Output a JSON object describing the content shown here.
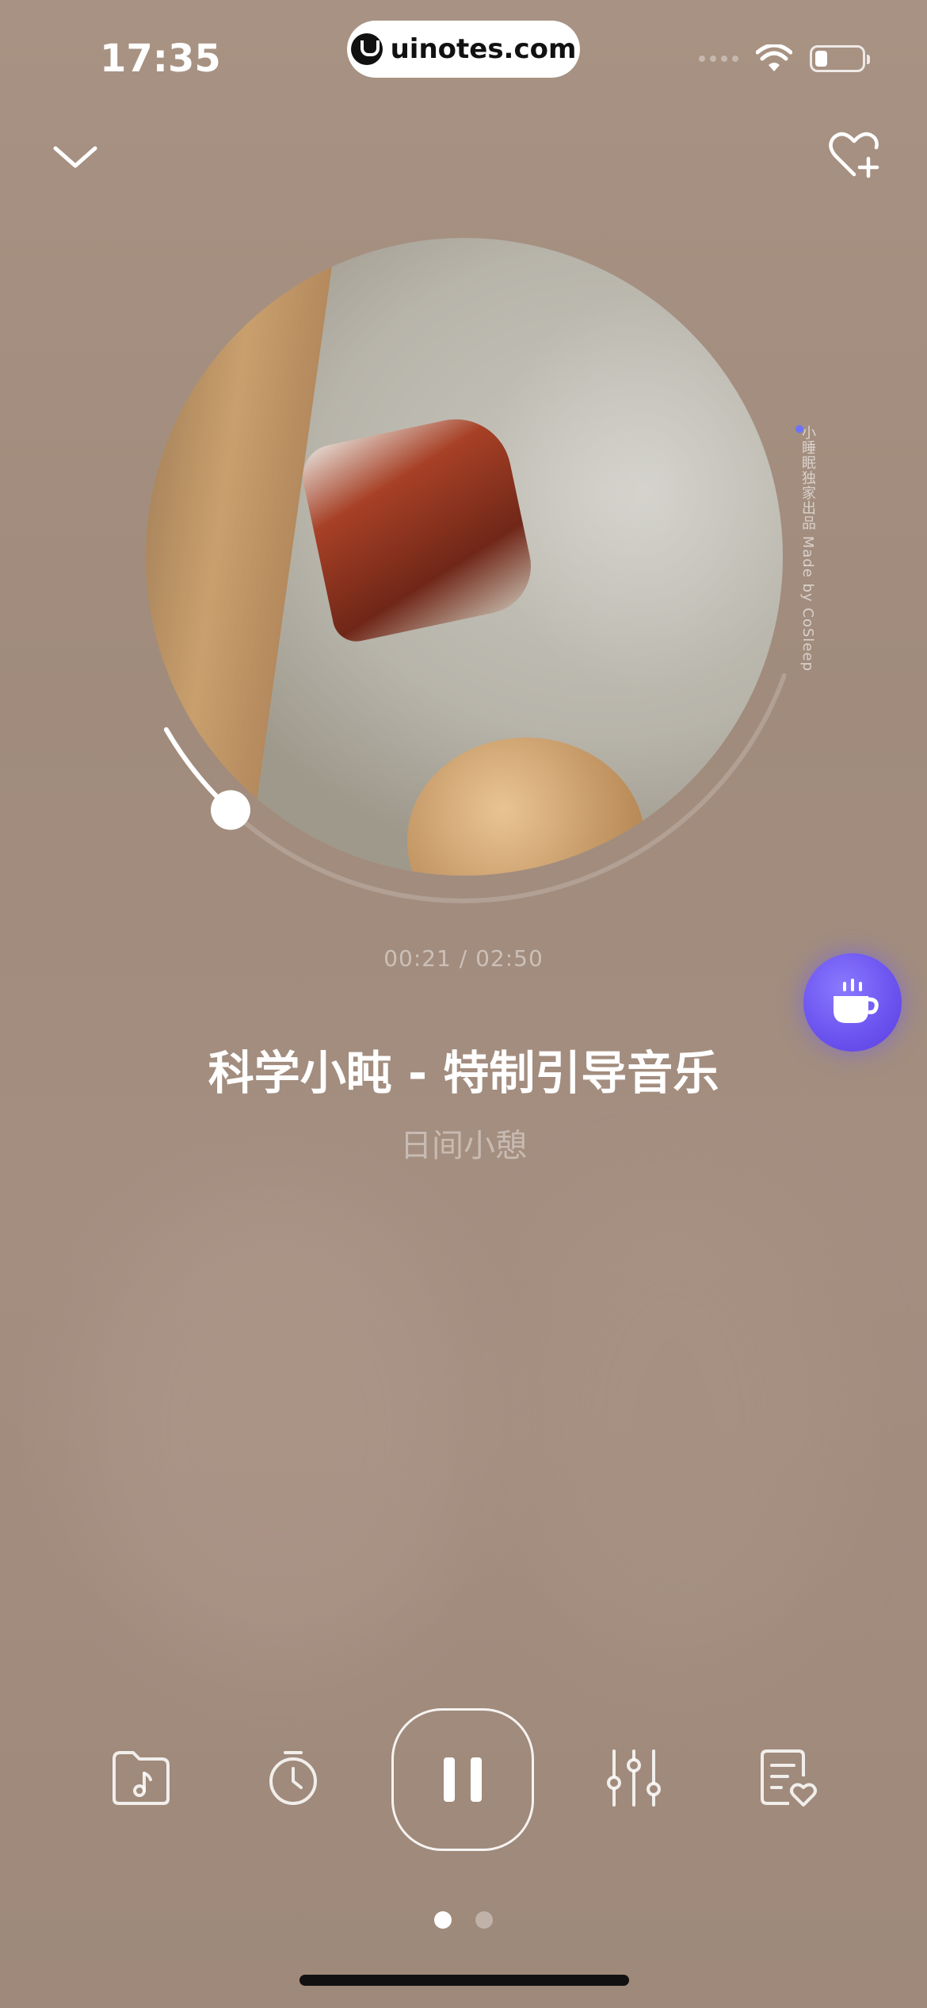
{
  "status_bar": {
    "time": "17:35",
    "url": "uinotes.com",
    "icons": [
      "signal-icon",
      "wifi-icon",
      "battery-icon"
    ],
    "battery_level": 0.25
  },
  "header": {
    "collapse_icon": "chevron-down-icon",
    "favorite_icon": "heart-plus-icon"
  },
  "artwork": {
    "credit_text": "小睡眠独家出品 Made by CoSleep",
    "progress_fraction": 0.133
  },
  "player": {
    "time_display": "00:21 / 02:50",
    "title": "科学小盹 - 特制引导音乐",
    "subtitle": "日间小憩"
  },
  "floating": {
    "icon": "coffee-cup-icon",
    "color": "#6d55f0"
  },
  "controls": [
    {
      "name": "music-folder-icon"
    },
    {
      "name": "timer-icon"
    },
    {
      "name": "pause-icon"
    },
    {
      "name": "mixer-icon"
    },
    {
      "name": "favorites-list-icon"
    }
  ],
  "pager": {
    "count": 2,
    "active_index": 0
  }
}
